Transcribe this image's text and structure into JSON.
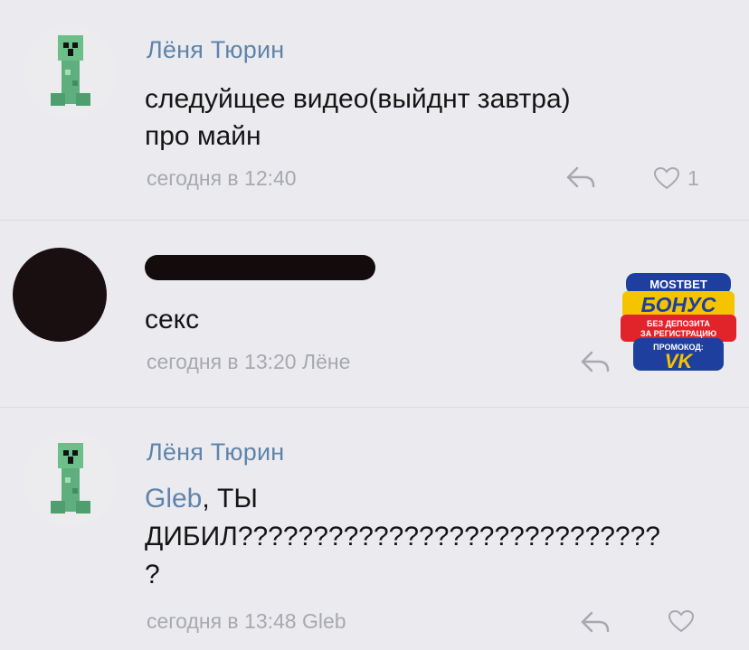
{
  "comments": [
    {
      "author": "Лёня Тюрин",
      "text_line1": "следуйщее видео(выйднт завтра)",
      "text_line2": "про майн",
      "timestamp": "сегодня в 12:40",
      "like_count": "1"
    },
    {
      "author": "",
      "text_line1": "секс",
      "timestamp": "сегодня в 13:20 Лёне"
    },
    {
      "author": "Лёня Тюрин",
      "mention": "Gleb",
      "text_line1_rest": ", ТЫ",
      "text_line2": "ДИБИЛ????????????????????????????",
      "text_line3": "?",
      "timestamp": "сегодня в 13:48 Gleb"
    }
  ],
  "ad": {
    "brand": "MOSTBET",
    "headline": "БОНУС",
    "line1": "БЕЗ ДЕПОЗИТА",
    "line2": "ЗА РЕГИСТРАЦИЮ",
    "promo_label": "ПРОМОКОД:",
    "promo_code": "VK"
  },
  "colors": {
    "background": "#ebebef",
    "author": "#5f84ab",
    "meta": "#a7a9ae",
    "ad_blue": "#1f3f9e",
    "ad_yellow": "#f5c400"
  }
}
